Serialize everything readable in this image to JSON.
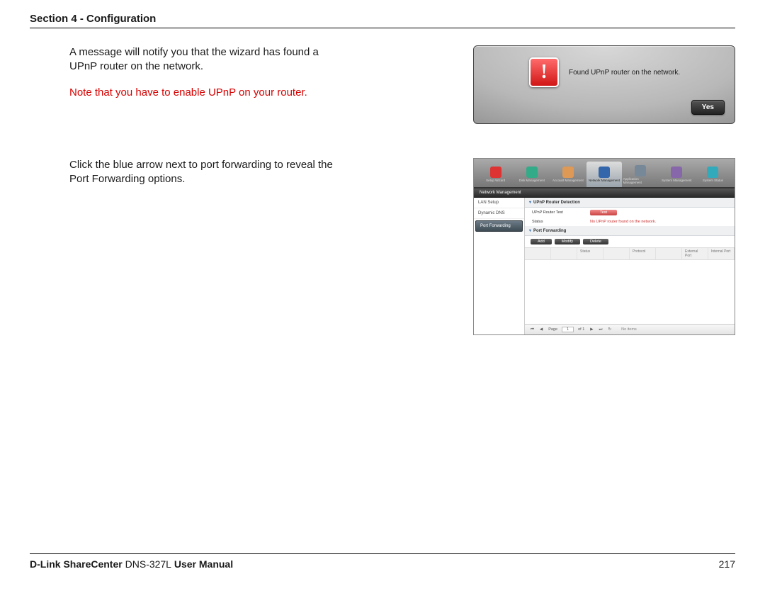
{
  "header": {
    "title": "Section 4 - Configuration"
  },
  "blocks": [
    {
      "text": {
        "p1": "A message will notify you that the wizard has found a UPnP router on the network.",
        "note": "Note that you have to enable UPnP on your router."
      },
      "dialog": {
        "message": "Found UPnP router on the network.",
        "yes": "Yes"
      }
    },
    {
      "text": {
        "p1": "Click the blue arrow next to port forwarding to reveal the Port Forwarding options."
      },
      "app": {
        "toolbar": [
          {
            "label": "Setup Wizard"
          },
          {
            "label": "Disk Management"
          },
          {
            "label": "Account Management"
          },
          {
            "label": "Network Management"
          },
          {
            "label": "Application Management"
          },
          {
            "label": "System Management"
          },
          {
            "label": "System Status"
          }
        ],
        "section": "Network Management",
        "side": [
          {
            "label": "LAN Setup"
          },
          {
            "label": "Dynamic DNS"
          },
          {
            "label": "Port Forwarding"
          }
        ],
        "panel1": {
          "title": "UPnP Router Detection",
          "row1k": "UPnP Router Test",
          "row1btn": "Test",
          "row2k": "Status",
          "row2v": "No UPnP router found on the network."
        },
        "panel2": {
          "title": "Port Forwarding",
          "btns": [
            "Add",
            "Modify",
            "Delete"
          ],
          "cols": [
            "",
            "",
            "Status",
            "",
            "Protocol",
            "",
            "External Port",
            "Internal Port"
          ]
        },
        "pager": {
          "page_label": "Page",
          "page_value": "1",
          "total": "of 1",
          "refresh": "↻",
          "msg": "No items"
        }
      }
    }
  ],
  "footer": {
    "brand": "D-Link ShareCenter",
    "model": "DNS-327L",
    "suffix": "User Manual",
    "page": "217"
  }
}
